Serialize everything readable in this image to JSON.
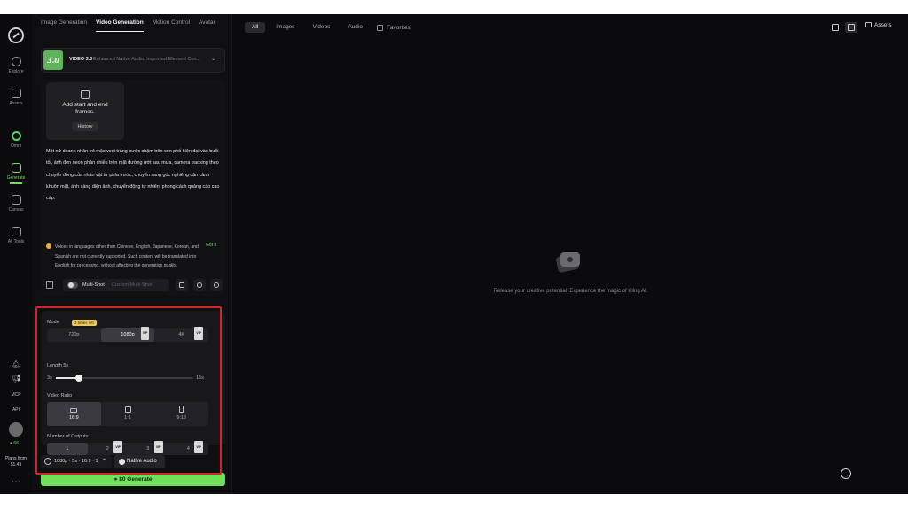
{
  "rail": {
    "items": [
      {
        "label": "Explore"
      },
      {
        "label": "Assets"
      },
      {
        "label": "Omni"
      },
      {
        "label": "Generate"
      },
      {
        "label": "Canvas"
      },
      {
        "label": "All Tools"
      }
    ],
    "mcp": "MCP",
    "api": "API",
    "credits": "66",
    "plans_label": "Plans from",
    "plans_price": "$1.49",
    "more": "···"
  },
  "tabs": [
    "Image Generation",
    "Video Generation",
    "Motion Control",
    "Avatar"
  ],
  "model": {
    "badge": "3.0",
    "name": "VIDEO 3.0",
    "description": "Enhanced Native Audio, Improved Element Con..."
  },
  "frames": {
    "label": "Add start and end frames.",
    "history": "History"
  },
  "prompt": "Một nữ doanh nhân trẻ mặc vest trắng bước chậm trên con phố hiện đại vào buổi tối, ánh đèn neon phản chiếu trên mặt đường ướt sau mưa, camera tracking theo chuyển động của nhân vật từ phía trước, chuyển sang góc nghiêng cận cảnh khuôn mặt, ánh sáng điện ảnh, chuyển động tự nhiên, phong cách quảng cáo cao cấp.",
  "notice": {
    "text": "Voices in languages other than Chinese, English, Japanese, Korean, and Spanish are not currently supported. Such content will be translated into English for processing, without affecting the generation quality.",
    "dismiss": "Got it"
  },
  "multishot": {
    "label": "Multi-Shot",
    "custom": "Custom Multi-Shot"
  },
  "settings": {
    "mode_label": "Mode",
    "limit_badge": "3 times left",
    "modes": [
      "720p",
      "1080p",
      "4K"
    ],
    "mode_selected": "1080p",
    "length_label": "Length 5s",
    "length_min": "3s",
    "length_max": "15s",
    "length_value": 5,
    "length_range": [
      3,
      15
    ],
    "ratio_label": "Video Ratio",
    "ratios": [
      "16:9",
      "1:1",
      "9:16"
    ],
    "ratio_selected": "16:9",
    "outputs_label": "Number of Outputs",
    "outputs": [
      "1",
      "2",
      "3",
      "4"
    ],
    "outputs_selected": "1",
    "vip": "VIP"
  },
  "summary": {
    "text": "1080p · 5s · 16:9 · 1",
    "native_audio": "Native Audio"
  },
  "generate": {
    "credits": "80",
    "label": "Generate"
  },
  "main": {
    "filters": [
      "All",
      "Images",
      "Videos",
      "Audio"
    ],
    "filter_selected": "All",
    "favorites": "Favorites",
    "assets": "Assets",
    "empty_message": "Release your creative potential. Experience the magic of Kling AI."
  },
  "colors": {
    "accent": "#6ee05a",
    "highlight_outline": "#d3232b",
    "background": "#0b0b0d"
  }
}
